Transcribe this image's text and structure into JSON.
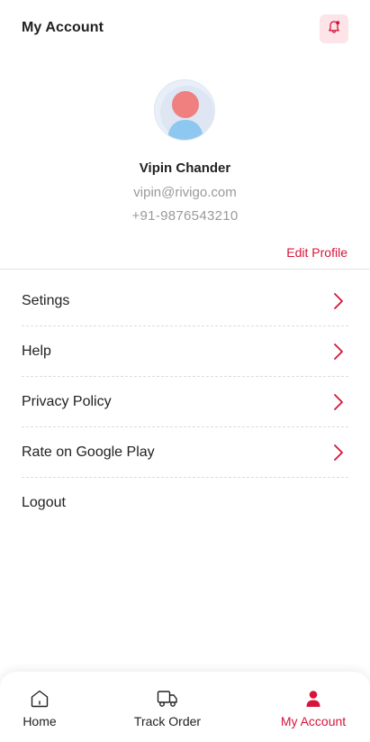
{
  "header": {
    "title": "My Account",
    "notification_icon": "bell-icon"
  },
  "profile": {
    "avatar_icon": "user-avatar-icon",
    "name": "Vipin Chander",
    "email": "vipin@rivigo.com",
    "phone": "+91-9876543210",
    "edit_label": "Edit Profile"
  },
  "menu": {
    "items": [
      {
        "label": "Setings",
        "icon": "chevron-right-icon"
      },
      {
        "label": "Help",
        "icon": "chevron-right-icon"
      },
      {
        "label": "Privacy Policy",
        "icon": "chevron-right-icon"
      },
      {
        "label": "Rate on Google Play",
        "icon": "chevron-right-icon"
      },
      {
        "label": "Logout"
      }
    ]
  },
  "bottom_nav": {
    "items": [
      {
        "label": "Home",
        "icon": "home-icon"
      },
      {
        "label": "Track Order",
        "icon": "truck-icon"
      },
      {
        "label": "My Account",
        "icon": "user-icon",
        "active": true
      }
    ]
  },
  "colors": {
    "accent": "#d6153a",
    "bell_bg": "#fce4e8",
    "muted_text": "#9a9a9a"
  }
}
